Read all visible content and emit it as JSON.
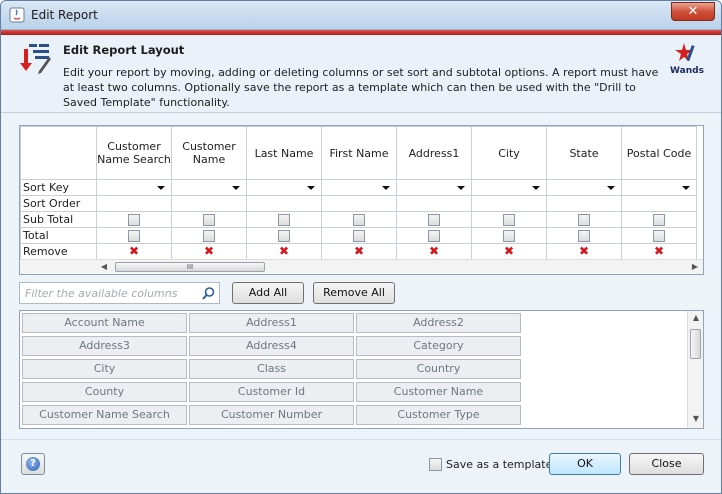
{
  "window": {
    "title": "Edit Report",
    "close_glyph": "✕"
  },
  "header": {
    "title": "Edit Report Layout",
    "description": "Edit your report by moving, adding or deleting columns or set sort and subtotal options. A report must have at least two columns. Optionally save the report as a template which can then be used with the \"Drill to Saved Template\" functionality.",
    "logo_label": "Wands"
  },
  "grid": {
    "columns": [
      "Customer Name Search",
      "Customer Name",
      "Last Name",
      "First Name",
      "Address1",
      "City",
      "State",
      "Postal Code"
    ],
    "row_labels": {
      "sort_key": "Sort Key",
      "sort_order": "Sort Order",
      "sub_total": "Sub Total",
      "total": "Total",
      "remove": "Remove"
    },
    "remove_glyph": "✖",
    "scroll_thumb_glyph": "III"
  },
  "filter": {
    "placeholder": "Filter the available columns",
    "icon": "search-icon"
  },
  "buttons": {
    "add_all": "Add All",
    "remove_all": "Remove All",
    "ok": "OK",
    "close": "Close"
  },
  "available_columns": [
    "Account Name",
    "Address1",
    "Address2",
    "Address3",
    "Address4",
    "Category",
    "City",
    "Class",
    "Country",
    "County",
    "Customer Id",
    "Customer Name",
    "Customer Name Search",
    "Customer Number",
    "Customer Type"
  ],
  "footer": {
    "save_template_label": "Save as a template",
    "save_template_checked": false
  },
  "colors": {
    "accent_red": "#c41e1e",
    "title_bar": "#c6d9ee",
    "remove_red": "#d8141c"
  }
}
